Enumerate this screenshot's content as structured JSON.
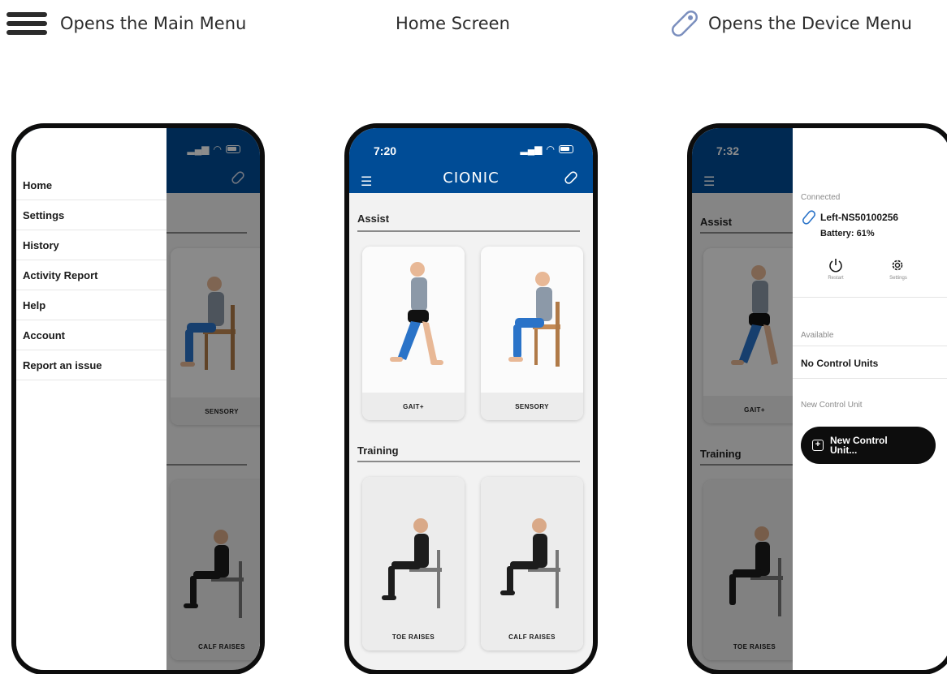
{
  "captions": {
    "main_menu": "Opens the Main Menu",
    "home": "Home Screen",
    "device_menu": "Opens the Device Menu"
  },
  "icons": {
    "main_menu": "hamburger-icon",
    "device_menu": "sensor-icon",
    "restart": "power-icon",
    "settings": "gear-icon",
    "add": "plus-square-icon"
  },
  "colors": {
    "brand_blue": "#004c96",
    "leg_blue": "#2a73c8",
    "button_black": "#0d0d0d"
  },
  "phone1": {
    "menu_items": [
      "Home",
      "Settings",
      "History",
      "Activity Report",
      "Help",
      "Account",
      "Report an issue"
    ],
    "cards": {
      "sensory": "SENSORY",
      "calf_raises": "CALF RAISES"
    }
  },
  "phone2": {
    "time": "7:20",
    "brand": "CIONIC",
    "sections": {
      "assist": "Assist",
      "training": "Training"
    },
    "cards": {
      "gait": "GAIT+",
      "sensory": "SENSORY",
      "toe_raises": "TOE RAISES",
      "calf_raises": "CALF RAISES"
    }
  },
  "phone3": {
    "time": "7:32",
    "sections": {
      "assist": "Assist",
      "training": "Training"
    },
    "cards": {
      "gait": "GAIT+",
      "toe_raises": "TOE RAISES"
    },
    "connected_label": "Connected",
    "device_name": "Left-NS50100256",
    "battery": "Battery: 61%",
    "restart_label": "Restart",
    "settings_label": "Settings",
    "available_label": "Available",
    "no_units": "No Control Units",
    "new_unit_label": "New Control Unit",
    "new_unit_button_line1": "New Control",
    "new_unit_button_line2": "Unit..."
  }
}
